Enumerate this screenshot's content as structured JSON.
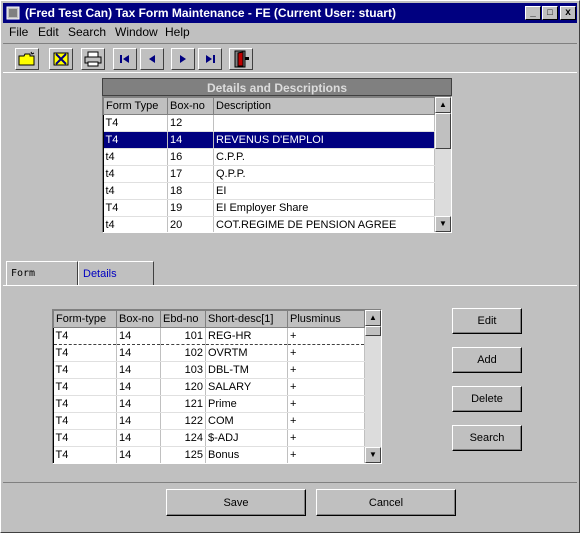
{
  "window": {
    "title": "(Fred Test Can) Tax Form Maintenance - FE (Current User: stuart)",
    "minimize": "_",
    "maximize": "□",
    "close": "x"
  },
  "menu": {
    "file": "File",
    "edit": "Edit",
    "search": "Search",
    "window": "Window",
    "help": "Help"
  },
  "toolbar": {
    "icons": [
      "open-folder-icon",
      "delete-x-icon",
      "print-icon",
      "first-record-icon",
      "previous-record-icon",
      "next-record-icon",
      "last-record-icon",
      "exit-door-icon"
    ]
  },
  "details": {
    "title": "Details and Descriptions",
    "columns": [
      "Form Type",
      "Box-no",
      "Description"
    ],
    "rows": [
      {
        "form_type": "T4",
        "box_no": "12",
        "description": ""
      },
      {
        "form_type": "T4",
        "box_no": "14",
        "description": "REVENUS D'EMPLOI",
        "selected": true
      },
      {
        "form_type": "t4",
        "box_no": "16",
        "description": "C.P.P."
      },
      {
        "form_type": "t4",
        "box_no": "17",
        "description": "Q.P.P."
      },
      {
        "form_type": "t4",
        "box_no": "18",
        "description": "EI"
      },
      {
        "form_type": "T4",
        "box_no": "19",
        "description": "EI Employer Share"
      },
      {
        "form_type": "t4",
        "box_no": "20",
        "description": "COT.REGIME DE PENSION AGREE"
      }
    ]
  },
  "tabs": {
    "form": "Form",
    "details": "Details"
  },
  "form_grid": {
    "columns": [
      "Form-type",
      "Box-no",
      "Ebd-no",
      "Short-desc[1]",
      "Plusminus"
    ],
    "rows": [
      {
        "form_type": "T4",
        "box_no": "14",
        "ebd_no": "101",
        "short_desc": "REG-HR",
        "plusminus": "+"
      },
      {
        "form_type": "T4",
        "box_no": "14",
        "ebd_no": "102",
        "short_desc": "OVRTM",
        "plusminus": "+"
      },
      {
        "form_type": "T4",
        "box_no": "14",
        "ebd_no": "103",
        "short_desc": "DBL-TM",
        "plusminus": "+"
      },
      {
        "form_type": "T4",
        "box_no": "14",
        "ebd_no": "120",
        "short_desc": "SALARY",
        "plusminus": "+"
      },
      {
        "form_type": "T4",
        "box_no": "14",
        "ebd_no": "121",
        "short_desc": "Prime",
        "plusminus": "+"
      },
      {
        "form_type": "T4",
        "box_no": "14",
        "ebd_no": "122",
        "short_desc": "COM",
        "plusminus": "+"
      },
      {
        "form_type": "T4",
        "box_no": "14",
        "ebd_no": "124",
        "short_desc": "$-ADJ",
        "plusminus": "+"
      },
      {
        "form_type": "T4",
        "box_no": "14",
        "ebd_no": "125",
        "short_desc": "Bonus",
        "plusminus": "+"
      }
    ]
  },
  "buttons": {
    "edit": "Edit",
    "add": "Add",
    "delete": "Delete",
    "search": "Search",
    "save": "Save",
    "cancel": "Cancel"
  }
}
